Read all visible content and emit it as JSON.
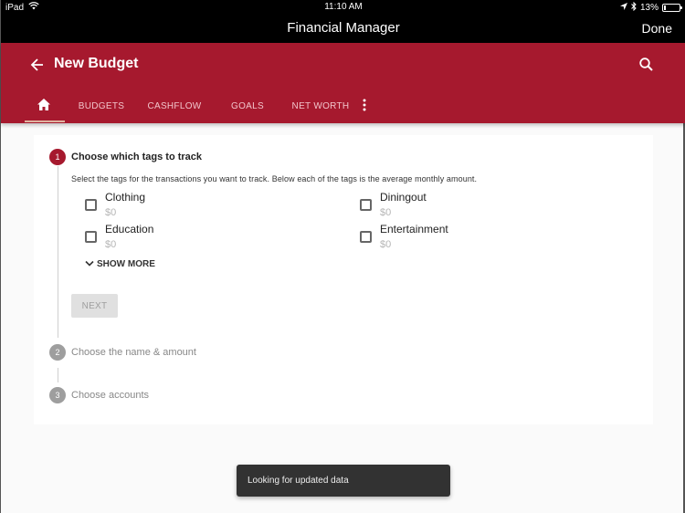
{
  "status_bar": {
    "device": "iPad",
    "time": "11:10 AM",
    "battery_percent_label": "13%",
    "battery_level": 0.13
  },
  "nav_bar": {
    "title": "Financial Manager",
    "done_label": "Done"
  },
  "app_bar": {
    "title": "New Budget",
    "back_icon": "arrow-left-icon",
    "search_icon": "search-icon"
  },
  "tabs": [
    {
      "label": "",
      "icon": "home-icon",
      "active": true
    },
    {
      "label": "BUDGETS",
      "active": false
    },
    {
      "label": "CASHFLOW",
      "active": false
    },
    {
      "label": "GOALS",
      "active": false
    },
    {
      "label": "NET WORTH",
      "active": false
    },
    {
      "label": "",
      "icon": "more-vert-icon",
      "active": false
    }
  ],
  "stepper": {
    "steps": [
      {
        "number": "1",
        "label": "Choose which tags to track",
        "active": true
      },
      {
        "number": "2",
        "label": "Choose the name & amount",
        "active": false
      },
      {
        "number": "3",
        "label": "Choose accounts",
        "active": false
      }
    ],
    "description": "Select the tags for the transactions you want to track. Below each of the tags is the average monthly amount.",
    "tags": [
      {
        "name": "Clothing",
        "amount": "$0",
        "checked": false
      },
      {
        "name": "Diningout",
        "amount": "$0",
        "checked": false
      },
      {
        "name": "Education",
        "amount": "$0",
        "checked": false
      },
      {
        "name": "Entertainment",
        "amount": "$0",
        "checked": false
      }
    ],
    "show_more_label": "SHOW MORE",
    "next_label": "NEXT"
  },
  "snackbar": {
    "message": "Looking for updated data"
  },
  "colors": {
    "brand": "#a6192e",
    "inactive_step": "#9e9e9e"
  }
}
